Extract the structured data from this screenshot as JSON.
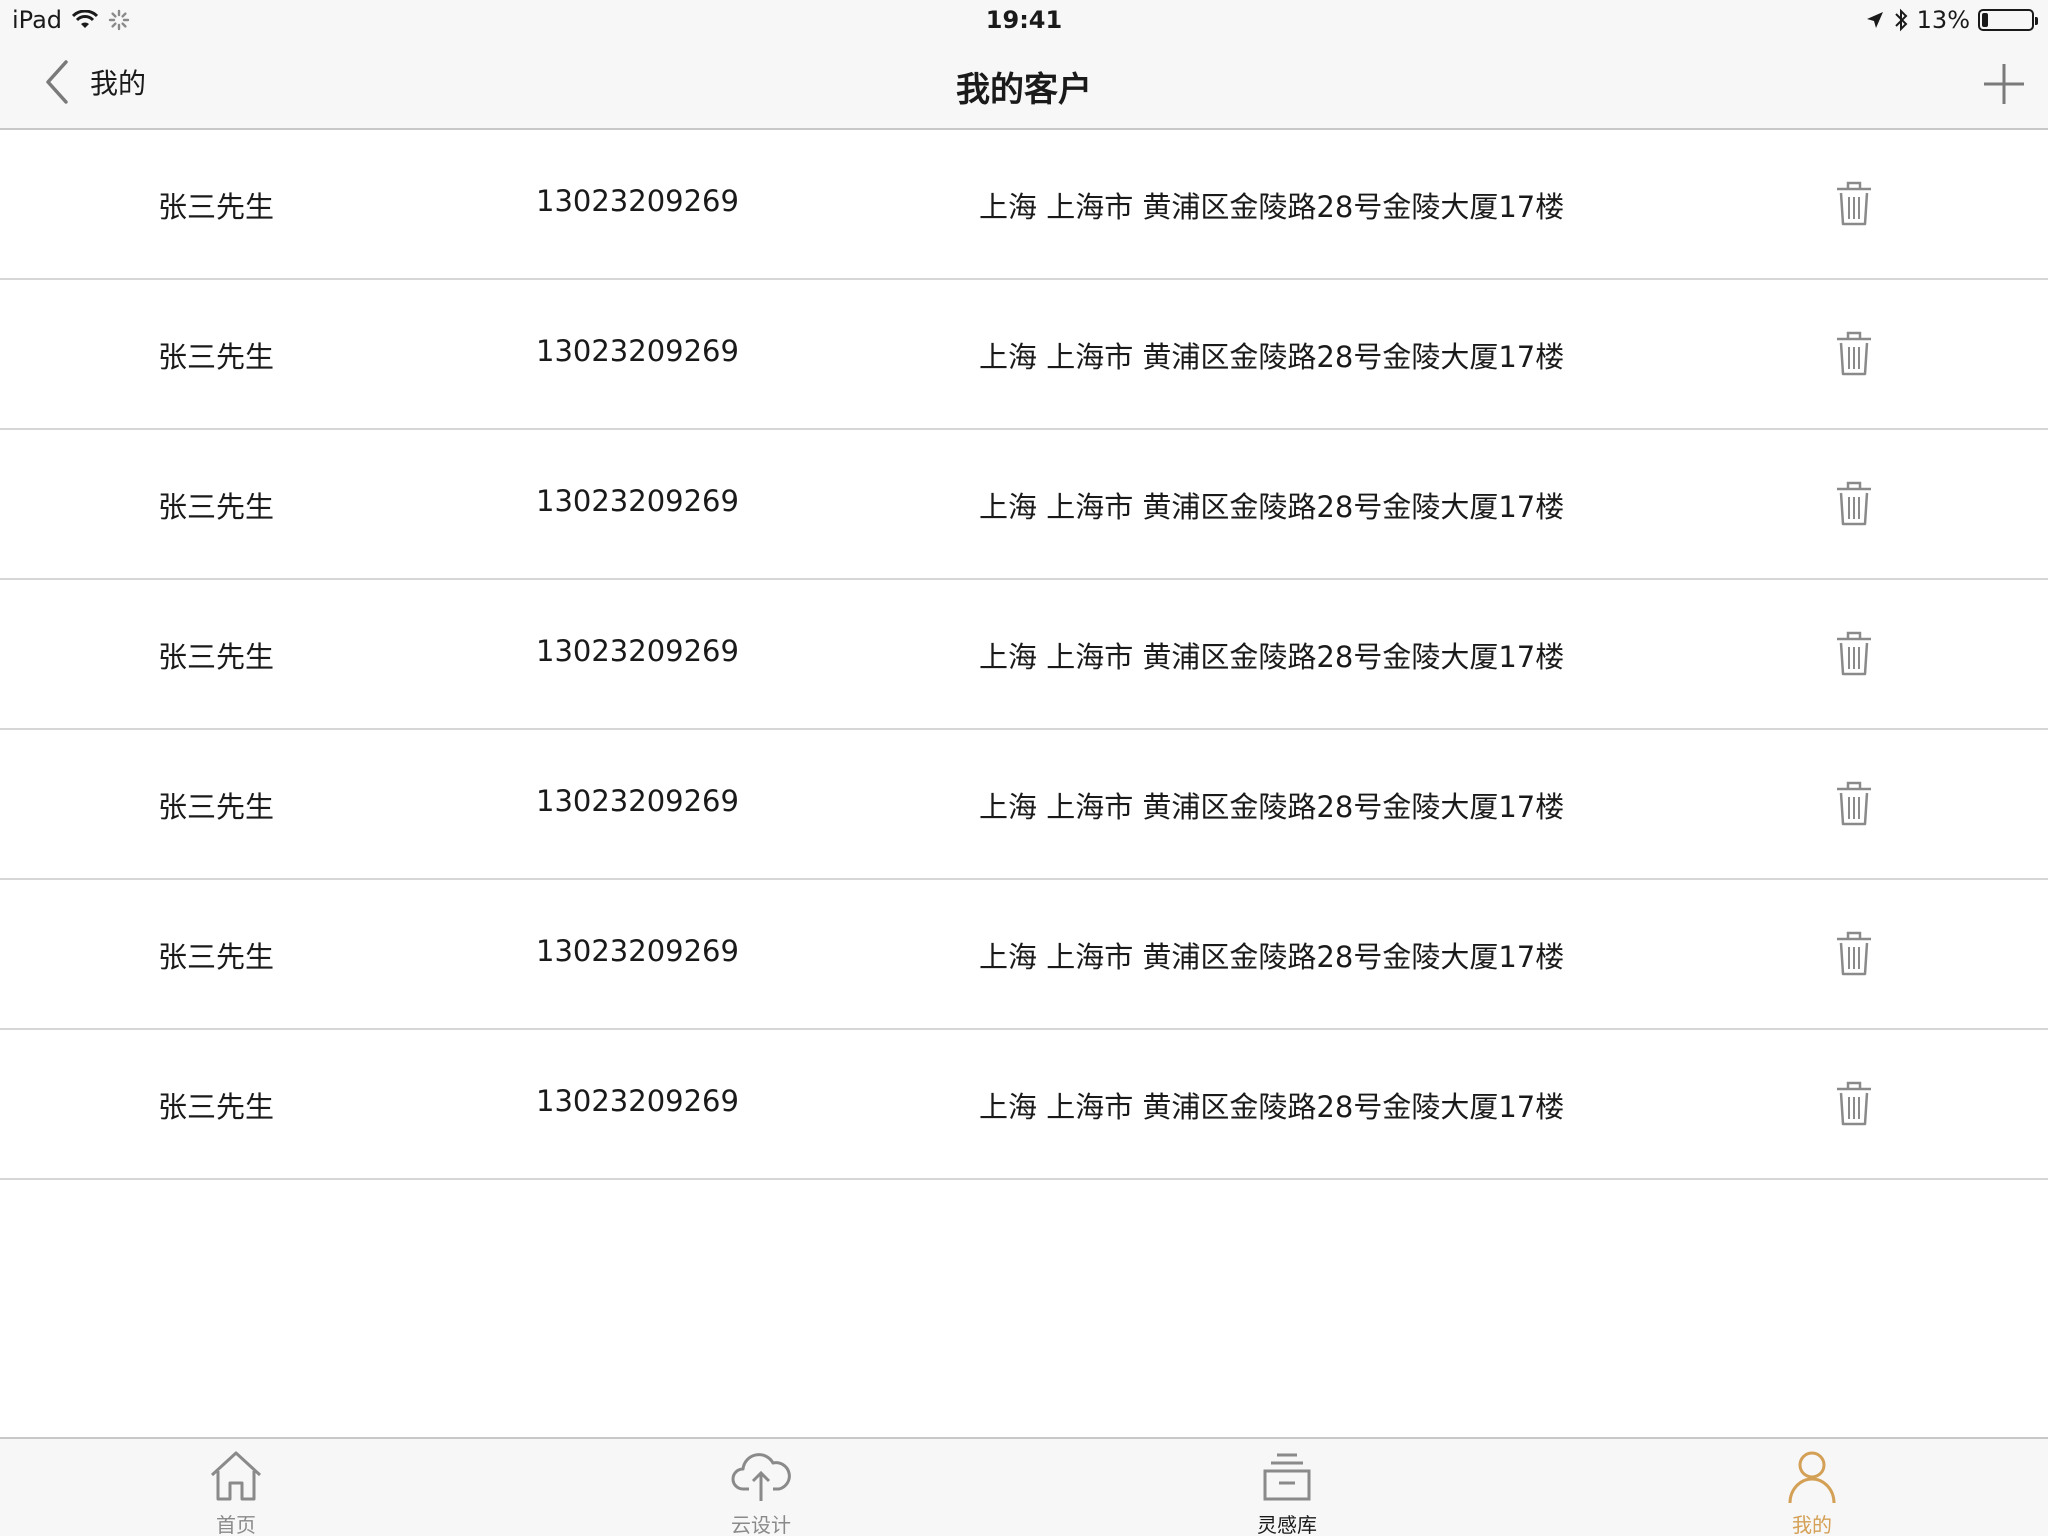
{
  "status_bar": {
    "device": "iPad",
    "time": "19:41",
    "battery_text": "13%",
    "battery_level": 0.13
  },
  "nav": {
    "back_label": "我的",
    "title": "我的客户"
  },
  "clients": [
    {
      "name": "张三先生",
      "phone": "13023209269",
      "address": "上海 上海市 黄浦区金陵路28号金陵大厦17楼"
    },
    {
      "name": "张三先生",
      "phone": "13023209269",
      "address": "上海 上海市 黄浦区金陵路28号金陵大厦17楼"
    },
    {
      "name": "张三先生",
      "phone": "13023209269",
      "address": "上海 上海市 黄浦区金陵路28号金陵大厦17楼"
    },
    {
      "name": "张三先生",
      "phone": "13023209269",
      "address": "上海 上海市 黄浦区金陵路28号金陵大厦17楼"
    },
    {
      "name": "张三先生",
      "phone": "13023209269",
      "address": "上海 上海市 黄浦区金陵路28号金陵大厦17楼"
    },
    {
      "name": "张三先生",
      "phone": "13023209269",
      "address": "上海 上海市 黄浦区金陵路28号金陵大厦17楼"
    },
    {
      "name": "张三先生",
      "phone": "13023209269",
      "address": "上海 上海市 黄浦区金陵路28号金陵大厦17楼"
    }
  ],
  "tabs": [
    {
      "label": "首页",
      "icon": "home-icon",
      "active": false
    },
    {
      "label": "云设计",
      "icon": "cloud-upload-icon",
      "active": false
    },
    {
      "label": "灵感库",
      "icon": "inbox-icon",
      "active": false
    },
    {
      "label": "我的",
      "icon": "person-icon",
      "active": true
    }
  ],
  "colors": {
    "accent": "#d4a055",
    "inactive": "#8a8a8a",
    "divider": "#d6d6d6",
    "bar_background": "#f7f7f7"
  }
}
